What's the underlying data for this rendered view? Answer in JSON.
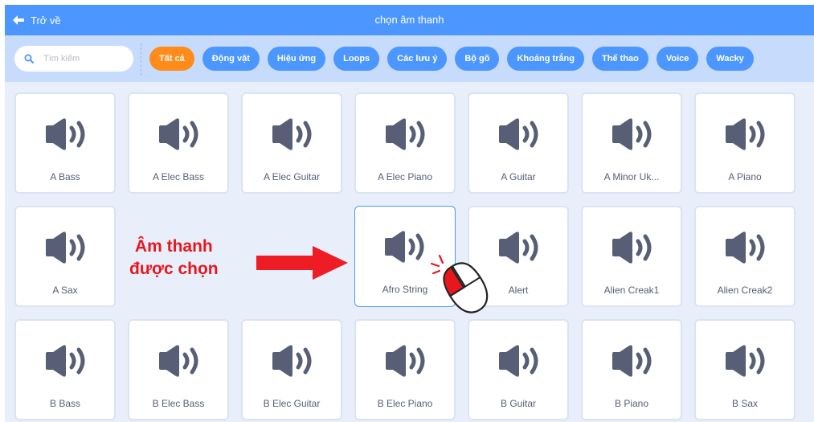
{
  "header": {
    "back_label": "Trở về",
    "title": "chọn âm thanh"
  },
  "search": {
    "placeholder": "Tìm kiếm"
  },
  "categories": [
    {
      "label": "Tất cả",
      "active": true
    },
    {
      "label": "Động vật",
      "active": false
    },
    {
      "label": "Hiệu ứng",
      "active": false
    },
    {
      "label": "Loops",
      "active": false
    },
    {
      "label": "Các lưu ý",
      "active": false
    },
    {
      "label": "Bộ gõ",
      "active": false
    },
    {
      "label": "Khoảng trắng",
      "active": false
    },
    {
      "label": "Thể thao",
      "active": false
    },
    {
      "label": "Voice",
      "active": false
    },
    {
      "label": "Wacky",
      "active": false
    }
  ],
  "sounds": [
    "A Bass",
    "A Elec Bass",
    "A Elec Guitar",
    "A Elec Piano",
    "A Guitar",
    "A Minor Uk...",
    "A Piano",
    "A Sax",
    "Afro String",
    "Alert",
    "Alien Creak1",
    "Alien Creak2",
    "B Bass",
    "B Elec Bass",
    "B Elec Guitar",
    "B Elec Piano",
    "B Guitar",
    "B Piano",
    "B Sax"
  ],
  "selected_sound": "Afro String",
  "annotation": {
    "line1": "Âm thanh",
    "line2": "được chọn"
  },
  "colors": {
    "header": "#4c97ff",
    "filter_bar": "#c7dbfd",
    "active_chip": "#ff8c1a",
    "annotation": "#e8171e",
    "speaker_icon": "#575e75"
  }
}
